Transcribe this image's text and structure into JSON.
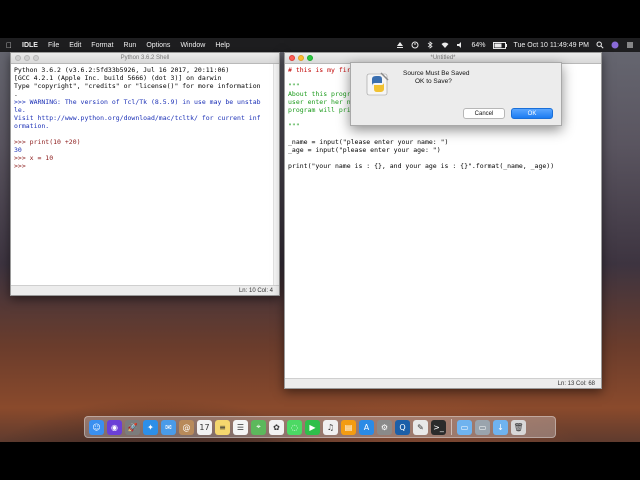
{
  "menubar": {
    "apple_icon": "apple-icon",
    "app_name": "IDLE",
    "menus": [
      "File",
      "Edit",
      "Format",
      "Run",
      "Options",
      "Window",
      "Help"
    ],
    "battery": "64%",
    "clock": "Tue Oct 10  11:49:49 PM"
  },
  "shell": {
    "title": "Python 3.6.2 Shell",
    "lines": [
      {
        "cls": "",
        "text": "Python 3.6.2 (v3.6.2:5fd33b5926, Jul 16 2017, 20:11:06)"
      },
      {
        "cls": "",
        "text": "[GCC 4.2.1 (Apple Inc. build 5666) (dot 3)] on darwin"
      },
      {
        "cls": "",
        "text": "Type \"copyright\", \"credits\" or \"license()\" for more information"
      },
      {
        "cls": "",
        "text": "."
      },
      {
        "cls": "c-out",
        "text": ">>> WARNING: The version of Tcl/Tk (8.5.9) in use may be unstab"
      },
      {
        "cls": "c-out",
        "text": "le."
      },
      {
        "cls": "c-out",
        "text": "Visit http://www.python.org/download/mac/tcltk/ for current inf"
      },
      {
        "cls": "c-out",
        "text": "ormation."
      },
      {
        "cls": "",
        "text": ""
      },
      {
        "cls": "c-prompt",
        "text": ">>> print(10 +20)"
      },
      {
        "cls": "c-out",
        "text": "30"
      },
      {
        "cls": "c-prompt",
        "text": ">>> x = 10"
      },
      {
        "cls": "c-prompt",
        "text": ">>> "
      }
    ],
    "status": "Ln: 10   Col: 4"
  },
  "editor": {
    "title": "*Untitled*",
    "lines": [
      {
        "cls": "c-red",
        "text": "# this is my fir"
      },
      {
        "cls": "",
        "text": ""
      },
      {
        "cls": "c-green",
        "text": "\"\"\""
      },
      {
        "cls": "c-green",
        "text": "About this progr"
      },
      {
        "cls": "c-green",
        "text": "user enter her n"
      },
      {
        "cls": "c-green",
        "text": "program will pri"
      },
      {
        "cls": "",
        "text": ""
      },
      {
        "cls": "c-green",
        "text": "\"\"\""
      },
      {
        "cls": "",
        "text": ""
      },
      {
        "cls": "",
        "text": "_name = input(\"please enter your name: \")"
      },
      {
        "cls": "",
        "text": "_age = input(\"please enter your age: \")"
      },
      {
        "cls": "",
        "text": ""
      },
      {
        "cls": "",
        "text": "print(\"your name is : {}, and your age is : {}\".format(_name, _age))"
      }
    ],
    "status": "Ln: 13   Col: 68"
  },
  "dialog": {
    "title": "Source Must Be Saved",
    "message": "OK to Save?",
    "cancel_label": "Cancel",
    "ok_label": "OK"
  },
  "dock": {
    "apps": [
      {
        "name": "finder-icon",
        "color": "#3a8ff0",
        "glyph": "☺"
      },
      {
        "name": "siri-icon",
        "color": "#6b3fd6",
        "glyph": "◉"
      },
      {
        "name": "launchpad-icon",
        "color": "#7c7c7c",
        "glyph": "🚀"
      },
      {
        "name": "safari-icon",
        "color": "#2d8fe8",
        "glyph": "✦"
      },
      {
        "name": "mail-icon",
        "color": "#4a9be8",
        "glyph": "✉"
      },
      {
        "name": "contacts-icon",
        "color": "#b88a5a",
        "glyph": "@"
      },
      {
        "name": "calendar-icon",
        "color": "#f2f2f2",
        "glyph": "17"
      },
      {
        "name": "notes-icon",
        "color": "#f5d76e",
        "glyph": "≡"
      },
      {
        "name": "reminders-icon",
        "color": "#f4f4f4",
        "glyph": "☰"
      },
      {
        "name": "maps-icon",
        "color": "#5cb85c",
        "glyph": "⌖"
      },
      {
        "name": "photos-icon",
        "color": "#f2f2f2",
        "glyph": "✿"
      },
      {
        "name": "messages-icon",
        "color": "#4cd964",
        "glyph": "◌"
      },
      {
        "name": "facetime-icon",
        "color": "#2fbf4a",
        "glyph": "▶"
      },
      {
        "name": "itunes-icon",
        "color": "#f0f0f0",
        "glyph": "♫"
      },
      {
        "name": "ibooks-icon",
        "color": "#f39c12",
        "glyph": "▤"
      },
      {
        "name": "appstore-icon",
        "color": "#2b8be6",
        "glyph": "A"
      },
      {
        "name": "preferences-icon",
        "color": "#8a8a8a",
        "glyph": "⚙"
      },
      {
        "name": "quicktime-icon",
        "color": "#1c5fa8",
        "glyph": "Q"
      },
      {
        "name": "idle-icon",
        "color": "#e8e8e8",
        "glyph": "✎"
      },
      {
        "name": "terminal-icon",
        "color": "#2b2b2b",
        "glyph": ">_"
      }
    ],
    "docs": [
      {
        "name": "folder-icon",
        "color": "#6fb3ef",
        "glyph": "▭"
      },
      {
        "name": "screenshot-icon",
        "color": "#9aa4ad",
        "glyph": "▭"
      },
      {
        "name": "downloads-icon",
        "color": "#6fb3ef",
        "glyph": "↓"
      },
      {
        "name": "trash-icon",
        "color": "#d8d8d8",
        "glyph": "🗑"
      }
    ]
  }
}
